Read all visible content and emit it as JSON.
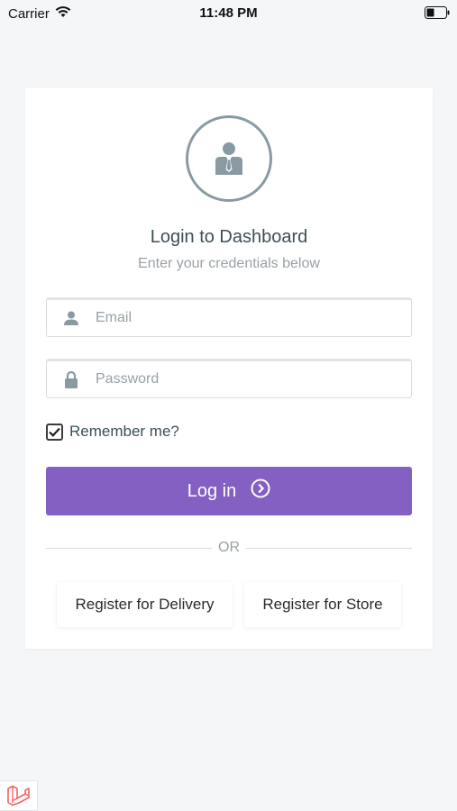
{
  "status_bar": {
    "carrier": "Carrier",
    "time": "11:48 PM",
    "wifi_icon": "wifi-icon",
    "battery_icon": "battery-icon"
  },
  "login": {
    "avatar_icon": "user-tie-icon",
    "title": "Login to Dashboard",
    "subtitle": "Enter your credentials below",
    "email": {
      "placeholder": "Email",
      "value": "",
      "icon": "user-icon"
    },
    "password": {
      "placeholder": "Password",
      "value": "",
      "icon": "lock-icon"
    },
    "remember_label": "Remember me?",
    "remember_checked": true,
    "login_button": "Log in",
    "login_button_icon": "chevron-right-circle-icon",
    "divider_text": "OR",
    "register_delivery": "Register for Delivery",
    "register_store": "Register for Store"
  },
  "footer": {
    "laravel_icon": "laravel-logo-icon"
  },
  "colors": {
    "accent": "#8460c2",
    "background": "#f5f6f8",
    "card": "#ffffff",
    "title_text": "#3d4f58",
    "muted_text": "#9aa1a6",
    "laravel": "#f4645f"
  }
}
